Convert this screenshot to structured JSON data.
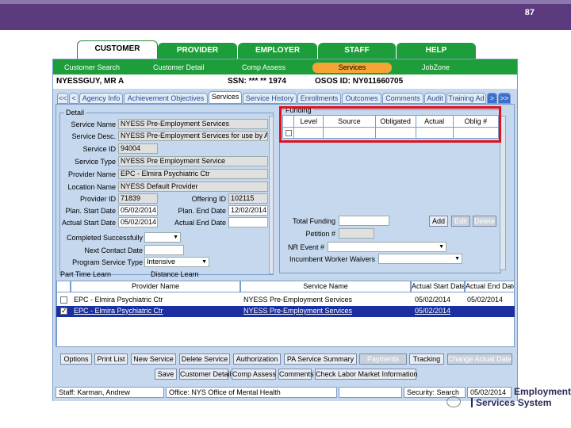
{
  "slide": {
    "number": "87"
  },
  "main_tabs": [
    "CUSTOMER",
    "PROVIDER",
    "EMPLOYER",
    "STAFF",
    "HELP"
  ],
  "subnav": [
    "Customer Search",
    "Customer Detail",
    "Comp Assess",
    "Services",
    "JobZone"
  ],
  "info": {
    "name": "NYESSGUY, MR A",
    "ssn": "SSN: *** ** 1974",
    "osos": "OSOS ID: NY011660705"
  },
  "subtabs": [
    "<<",
    "<",
    "Agency Info",
    "Achievement Objectives",
    "Services",
    "Service History",
    "Enrollments",
    "Outcomes",
    "Comments",
    "Audit",
    "Training Ad",
    ">",
    ">>"
  ],
  "detail": {
    "legend": "Detail",
    "service_name_label": "Service Name",
    "service_name": "NYESS Pre-Employment Services",
    "service_desc_label": "Service Desc.",
    "service_desc": "NYESS Pre-Employment Services for use by ALL En",
    "service_id_label": "Service ID",
    "service_id": "94004",
    "service_type_label": "Service Type",
    "service_type": "NYESS Pre Employment Service",
    "provider_name_label": "Provider Name",
    "provider_name": "EPC - Elmira Psychiatric Ctr",
    "location_name_label": "Location Name",
    "location_name": "NYESS Default Provider",
    "provider_id_label": "Provider ID",
    "provider_id": "71839",
    "offering_id_label": "Offering ID",
    "offering_id": "102115",
    "plan_start_label": "Plan. Start Date",
    "plan_start": "05/02/2014",
    "plan_end_label": "Plan. End Date",
    "plan_end": "12/02/2014",
    "actual_start_label": "Actual Start Date",
    "actual_start": "05/02/2014",
    "actual_end_label": "Actual End Date",
    "actual_end": "",
    "completed_label": "Completed Successfully",
    "next_contact_label": "Next Contact Date",
    "program_type_label": "Program Service Type",
    "program_type": "Intensive",
    "part_time_label": "Part Time Learn",
    "distance_label": "Distance Learn"
  },
  "funding": {
    "legend": "Funding",
    "columns": [
      "Level",
      "Source",
      "Obligated",
      "Actual",
      "Oblig #"
    ],
    "total_label": "Total Funding",
    "petition_label": "Petition #",
    "nr_event_label": "NR Event #",
    "incumbent_label": "Incumbent Worker Waivers",
    "add": "Add",
    "edit": "Edit",
    "delete": "Delete"
  },
  "list": {
    "columns": [
      "Provider Name",
      "Service Name",
      "Actual Start Date",
      "Actual End Date"
    ],
    "rows": [
      {
        "provider": "EPC - Elmira Psychiatric Ctr",
        "service": "NYESS Pre-Employment Services",
        "start": "05/02/2014",
        "end": "05/02/2014"
      },
      {
        "provider": "EPC - Elmira Psychiatric Ctr",
        "service": "NYESS Pre-Employment Services",
        "start": "05/02/2014",
        "end": ""
      }
    ]
  },
  "buttons_row1": [
    "Options",
    "Print List",
    "New Service",
    "Delete Service",
    "Authorization",
    "PA Service Summary",
    "Payments",
    "Tracking",
    "Change Actual Date"
  ],
  "buttons_row2": [
    "Save",
    "Customer Detail",
    "Comp Assess",
    "Comments",
    "Check Labor Market Information"
  ],
  "status": {
    "staff": "Staff: Karman, Andrew",
    "office": "Office: NYS Office of Mental Health",
    "security": "Security: Search",
    "date": "05/02/2014"
  },
  "logo": {
    "line1": "Employment",
    "line2": "Services System"
  }
}
